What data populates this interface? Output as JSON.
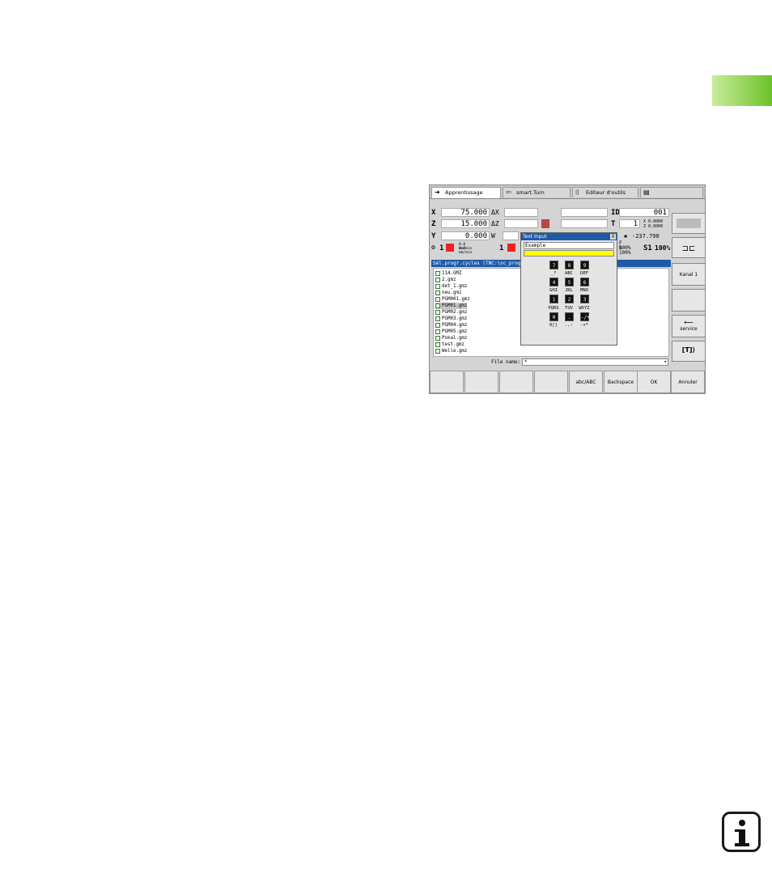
{
  "tabs": [
    {
      "label": "Apprentissage",
      "icon": "arrow-right-icon"
    },
    {
      "label": "smart.Turn",
      "icon": "arrow-left-icon"
    },
    {
      "label": "Editeur d'outils",
      "icon": "tool-icon"
    },
    {
      "label": "",
      "icon": "save-icon"
    }
  ],
  "position": {
    "x": {
      "axis": "X",
      "value": "75.000",
      "delta": "ΔX"
    },
    "z": {
      "axis": "Z",
      "value": "15.000",
      "delta": "ΔZ"
    },
    "y": {
      "axis": "Y",
      "value": "0.000",
      "delta": "W"
    }
  },
  "tool": {
    "id_label": "ID",
    "id_value": "001",
    "t_label": "T",
    "t_value": "1",
    "x_small": "X 0.0000",
    "z_small": "Z 0.0000",
    "angle": "-237.790",
    "feed": "F 100%",
    "rapid": "R 100%",
    "spindle": "S1",
    "spindle_override": "100%",
    "feed_values_1": "0.0 mm/min",
    "feed_values_2": "0.0 mm/min",
    "channel_1": "1",
    "channel_2": "1"
  },
  "side_buttons": [
    "",
    "",
    "Kanal 1",
    "",
    "service",
    ""
  ],
  "filelist": {
    "title": "Sél.progr.cycles  (TNC:\\nc_prog\\",
    "files": [
      "114.GMZ",
      "2.gmz",
      "det_1.gmz",
      "neu.gmz",
      "PGM001.gmz",
      "PGM01.gmz",
      "PGM02.gmz",
      "PGM03.gmz",
      "PGM04.gmz",
      "PGM05.gmz",
      "Pokal.gmz",
      "test.gmz",
      "Welle.gmz"
    ],
    "selected_index": 5
  },
  "filename": {
    "label": "File name:",
    "value": "*"
  },
  "dialog": {
    "title": "Text Input",
    "close": "X",
    "input_value": "Example",
    "keys": [
      {
        "key": "7",
        "label": ""
      },
      {
        "key": "8",
        "label": ""
      },
      {
        "key": "9",
        "label": ""
      },
      {
        "key": "4",
        "label": "_?"
      },
      {
        "key": "5",
        "label": "ABC"
      },
      {
        "key": "6",
        "label": "DEF"
      },
      {
        "key": "1",
        "label": "GHI"
      },
      {
        "key": "2",
        "label": "JKL"
      },
      {
        "key": "3",
        "label": "MNO"
      },
      {
        "key": "0",
        "label": "PQRS"
      },
      {
        "key": ".",
        "label": "TUV"
      },
      {
        "key": "-/+",
        "label": "WXYZ"
      }
    ],
    "bottom_labels": [
      "0[]",
      ".,:",
      "-+*"
    ]
  },
  "softkeys": [
    "",
    "",
    "",
    "",
    "abc/ABC",
    "Backspace",
    "OK",
    "Annuler"
  ]
}
